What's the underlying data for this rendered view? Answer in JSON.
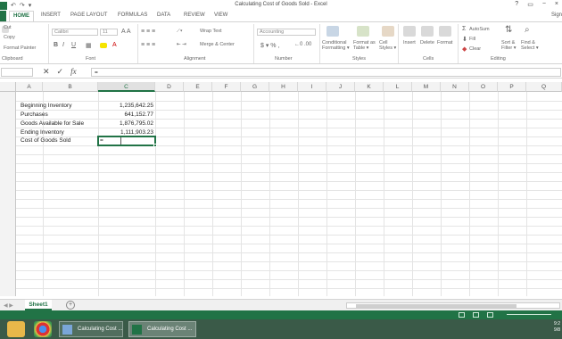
{
  "titlebar": {
    "doc_title": "Calculating Cost of Goods Sold - Excel",
    "window_buttons": [
      "?",
      "▭",
      "−",
      "×"
    ],
    "signin": "Sign"
  },
  "tabs": [
    "HOME",
    "INSERT",
    "PAGE LAYOUT",
    "FORMULAS",
    "DATA",
    "REVIEW",
    "VIEW"
  ],
  "ribbon": {
    "clipboard": {
      "cut": "Cut",
      "copy": "Copy",
      "format_painter": "Format Painter",
      "label": "Clipboard"
    },
    "font": {
      "name": "Calibri",
      "size": "11",
      "label": "Font"
    },
    "alignment": {
      "wrap_text": "Wrap Text",
      "merge_center": "Merge & Center",
      "label": "Alignment"
    },
    "number": {
      "format": "Accounting",
      "label": "Number"
    },
    "styles": {
      "conditional": "Conditional Formatting",
      "format_as_table": "Format as Table",
      "cell_styles": "Cell Styles",
      "label": "Styles"
    },
    "cells": {
      "insert": "Insert",
      "delete": "Delete",
      "format": "Format",
      "label": "Cells"
    },
    "editing": {
      "autosum": "AutoSum",
      "fill": "Fill",
      "clear": "Clear",
      "sort_filter": "Sort & Filter",
      "find_select": "Find & Select",
      "label": "Editing"
    }
  },
  "formula_bar": {
    "value": "="
  },
  "columns": [
    "A",
    "B",
    "C",
    "D",
    "E",
    "F",
    "G",
    "H",
    "I",
    "J",
    "K",
    "L",
    "M",
    "N",
    "O",
    "P",
    "Q"
  ],
  "rows": [
    {
      "label": "Beginning Inventory",
      "value": "1,235,642.25"
    },
    {
      "label": "Purchases",
      "value": "641,152.77"
    },
    {
      "label": "Goods Available for Sale",
      "value": "1,876,795.02"
    },
    {
      "label": "Ending Inventory",
      "value": "1,111,903.23"
    },
    {
      "label": "Cost of Goods Sold",
      "value": "="
    }
  ],
  "sheets": [
    "Sheet1"
  ],
  "taskbar": {
    "items": [
      "Calculating Cost ...",
      "Calculating Cost ..."
    ],
    "tray_time": "9:2",
    "tray_date": "9/8"
  },
  "colors": {
    "excel_green": "#217346"
  }
}
